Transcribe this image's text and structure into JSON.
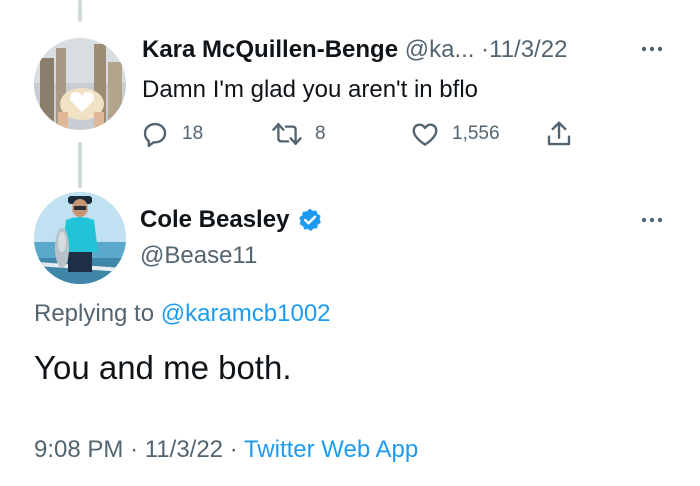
{
  "reply": {
    "author_name": "Kara McQuillen-Benge",
    "author_handle": "@ka...",
    "separator": "·",
    "date": "11/3/22",
    "text": "Damn I'm glad you aren't in bflo",
    "replies_count": "18",
    "retweets_count": "8",
    "likes_count": "1,556",
    "icons": [
      "reply-icon",
      "retweet-icon",
      "like-icon",
      "share-icon",
      "more-icon"
    ]
  },
  "tweet": {
    "author_name": "Cole Beasley",
    "author_handle": "@Bease11",
    "replying_prefix": "Replying to",
    "replying_to": "@karamcb1002",
    "text": "You and me both.",
    "time": "9:08 PM",
    "separator": "·",
    "date": "11/3/22",
    "source": "Twitter Web App",
    "icons": [
      "verified-badge-icon",
      "more-icon"
    ]
  },
  "colors": {
    "text": "#0f1419",
    "muted": "#536471",
    "link": "#1d9bf0",
    "thread_line": "#cfd9de"
  }
}
